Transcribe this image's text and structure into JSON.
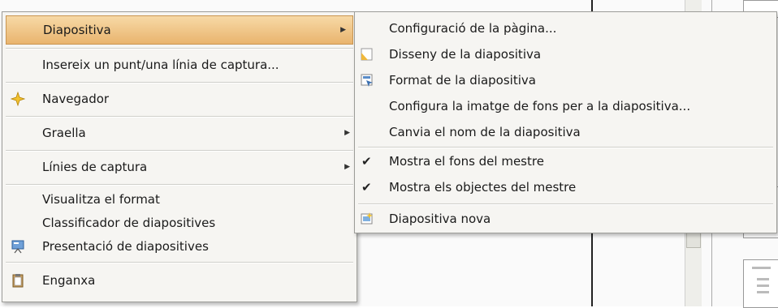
{
  "main_menu": {
    "items": [
      {
        "label": "Diapositiva",
        "submenu": true,
        "highlighted": true
      },
      {
        "label": "Insereix un punt/una línia de captura..."
      },
      {
        "label": "Navegador",
        "icon": "navigator-icon"
      },
      {
        "label": "Graella",
        "submenu": true
      },
      {
        "label": "Línies de captura",
        "submenu": true
      },
      {
        "label": "Visualitza el format"
      },
      {
        "label": "Classificador de diapositives"
      },
      {
        "label": "Presentació de diapositives",
        "icon": "slideshow-icon"
      },
      {
        "label": "Enganxa",
        "icon": "paste-icon"
      }
    ]
  },
  "submenu": {
    "items": [
      {
        "label": "Configuració de la pàgina..."
      },
      {
        "label": "Disseny de la diapositiva",
        "icon": "slide-design-icon"
      },
      {
        "label": "Format de la diapositiva",
        "icon": "slide-layout-icon"
      },
      {
        "label": "Configura la imatge de fons per a la diapositiva..."
      },
      {
        "label": "Canvia el nom de la diapositiva"
      },
      {
        "label": "Mostra el fons del mestre",
        "checked": true
      },
      {
        "label": "Mostra els objectes del mestre",
        "checked": true
      },
      {
        "label": "Diapositiva nova",
        "icon": "new-slide-icon"
      }
    ]
  },
  "colors": {
    "menu_bg": "#f6f5f2",
    "highlight_top": "#f7d9a6",
    "highlight_bottom": "#e9b46e"
  }
}
